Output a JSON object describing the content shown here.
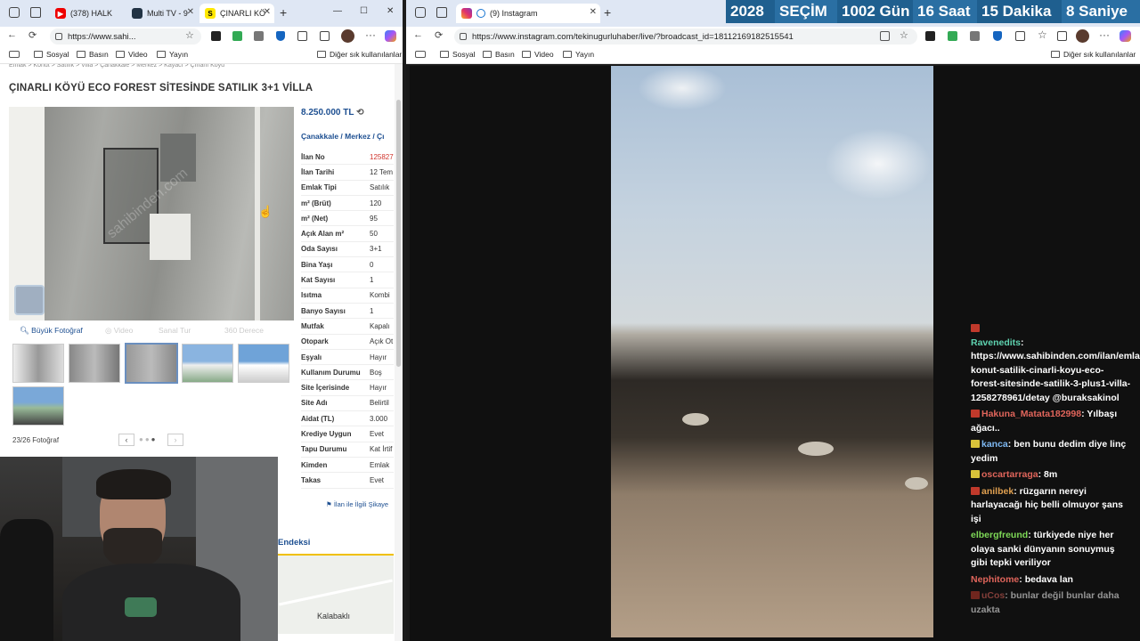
{
  "left_window": {
    "tabs": [
      {
        "label": "(378) HALK"
      },
      {
        "label": "Multi TV - 9"
      },
      {
        "label": "ÇINARLI KÖ"
      }
    ],
    "url": "https://www.sahi...",
    "bookmarks": [
      "Sosyal",
      "Basın",
      "Video",
      "Yayın"
    ],
    "bookmarks_right": "Diğer sık kullanılanlar",
    "breadcrumb_top": "Emlak  >  Konut  >  Satılık  >  Villa  >  Çanakkale  >  Merkez  >  Kayacı  >  Çınarlı Köyü",
    "listing": {
      "title": "ÇINARLI KÖYÜ ECO FOREST SİTESİNDE SATILIK 3+1 VİLLA",
      "price": "8.250.000 TL",
      "location": "Çanakkale  /  Merkez  /  Çı",
      "details": [
        {
          "k": "İlan No",
          "v": "125827"
        },
        {
          "k": "İlan Tarihi",
          "v": "12 Tem"
        },
        {
          "k": "Emlak Tipi",
          "v": "Satılık"
        },
        {
          "k": "m² (Brüt)",
          "v": "120"
        },
        {
          "k": "m² (Net)",
          "v": "95"
        },
        {
          "k": "Açık Alan m²",
          "v": "50"
        },
        {
          "k": "Oda Sayısı",
          "v": "3+1"
        },
        {
          "k": "Bina Yaşı",
          "v": "0"
        },
        {
          "k": "Kat Sayısı",
          "v": "1"
        },
        {
          "k": "Isıtma",
          "v": "Kombi"
        },
        {
          "k": "Banyo Sayısı",
          "v": "1"
        },
        {
          "k": "Mutfak",
          "v": "Kapalı"
        },
        {
          "k": "Otopark",
          "v": "Açık Ot"
        },
        {
          "k": "Eşyalı",
          "v": "Hayır"
        },
        {
          "k": "Kullanım Durumu",
          "v": "Boş"
        },
        {
          "k": "Site İçerisinde",
          "v": "Hayır"
        },
        {
          "k": "Site Adı",
          "v": "Belirtil"
        },
        {
          "k": "Aidat (TL)",
          "v": "3.000"
        },
        {
          "k": "Krediye Uygun",
          "v": "Evet"
        },
        {
          "k": "Tapu Durumu",
          "v": "Kat İrtif"
        },
        {
          "k": "Kimden",
          "v": "Emlak"
        },
        {
          "k": "Takas",
          "v": "Evet"
        }
      ],
      "big_photo_label": "Büyük Fotoğraf",
      "video_label": "Video",
      "sanal_tur_label": "Sanal Tur",
      "360_label": "360 Derece",
      "photo_count": "23/26 Fotoğraf",
      "watermark": "sahibinden.com",
      "complaint": "İlan ile İlgili Şikaye",
      "endeksi": "Endeksi",
      "map_label": "Kalabaklı"
    }
  },
  "right_window": {
    "tab_label": "(9) Instagram",
    "url": "https://www.instagram.com/tekinugurluhaber/live/?broadcast_id=18112169182515541",
    "bookmarks": [
      "Sosyal",
      "Basın",
      "Video",
      "Yayın"
    ],
    "bookmarks_right": "Diğer sık kullanılanlar"
  },
  "countdown": {
    "year": "2028",
    "label": "SEÇİM",
    "days": "1002 Gün",
    "hours": "16 Saat",
    "minutes": "15 Dakika",
    "seconds": "8 Saniye"
  },
  "chat": [
    {
      "user": "Ravenedits",
      "color": "#5fd3b0",
      "badge": "",
      "text": "https://www.sahibinden.com/ilan/emlak-konut-satilik-cinarli-koyu-eco-forest-sitesinde-satilik-3-plus1-villa-1258278961/detay @buraksakinol"
    },
    {
      "user": "Hakuna_Matata182998",
      "color": "#e0655b",
      "badge": "#c0392b",
      "text": "Yılbaşı ağacı.."
    },
    {
      "user": "kanca",
      "color": "#7db8f2",
      "badge": "#d8c23a",
      "text": "ben bunu dedim diye linç yedim"
    },
    {
      "user": "oscartarraga",
      "color": "#e0655b",
      "badge": "#d8c23a",
      "text": "8m"
    },
    {
      "user": "anilbek",
      "color": "#e0a050",
      "badge": "#c0392b",
      "text": "rüzgarın nereyi harlayacağı hiç belli olmuyor şans işi"
    },
    {
      "user": "elbergfreund",
      "color": "#7ed957",
      "badge": "",
      "text": "türkiyede niye her olaya sanki dünyanın sonuymuş gibi tepki veriliyor"
    },
    {
      "user": "Nephitome",
      "color": "#e0655b",
      "badge": "",
      "text": "bedava lan"
    },
    {
      "user": "uCos",
      "color": "#e0655b",
      "badge": "#c0392b",
      "text": "bunlar değil bunlar daha uzakta"
    }
  ]
}
